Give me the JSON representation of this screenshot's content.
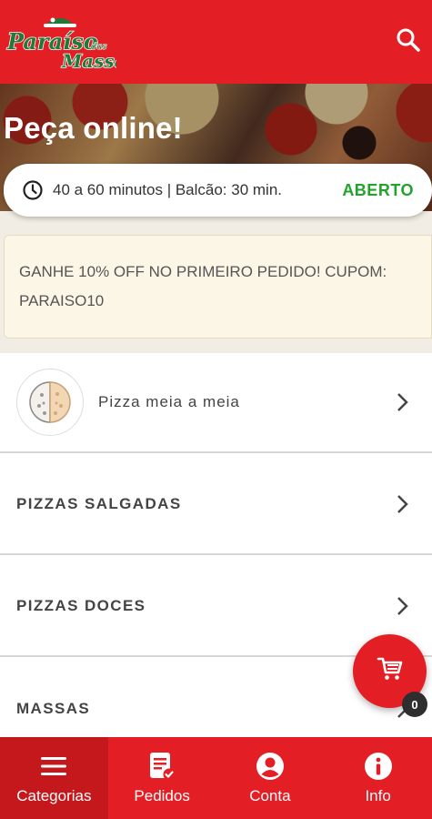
{
  "header": {
    "logo_line1": "Paraíso",
    "logo_small": "das",
    "logo_line2": "Massas",
    "search_icon": "search-icon"
  },
  "hero": {
    "title": "Peça online!"
  },
  "status": {
    "clock_icon": "clock-icon",
    "delivery_time": "40 a 60 minutos | Balcão: 30 min.",
    "state": "ABERTO",
    "state_color": "#22a32b"
  },
  "promo": {
    "text": "GANHE 10% OFF NO PRIMEIRO PEDIDO! CUPOM: PARAISO10"
  },
  "categories": [
    {
      "label": "Pizza meia a meia"
    },
    {
      "label": "PIZZAS SALGADAS"
    },
    {
      "label": "PIZZAS DOCES"
    },
    {
      "label": "MASSAS"
    }
  ],
  "cart": {
    "icon": "cart-icon",
    "count": "0"
  },
  "bottom_nav": [
    {
      "label": "Categorias",
      "icon": "menu-icon",
      "active": true
    },
    {
      "label": "Pedidos",
      "icon": "orders-icon",
      "active": false
    },
    {
      "label": "Conta",
      "icon": "account-icon",
      "active": false
    },
    {
      "label": "Info",
      "icon": "info-icon",
      "active": false
    }
  ],
  "colors": {
    "brand_red": "#e31e24",
    "brand_green": "#1f7a3a"
  }
}
